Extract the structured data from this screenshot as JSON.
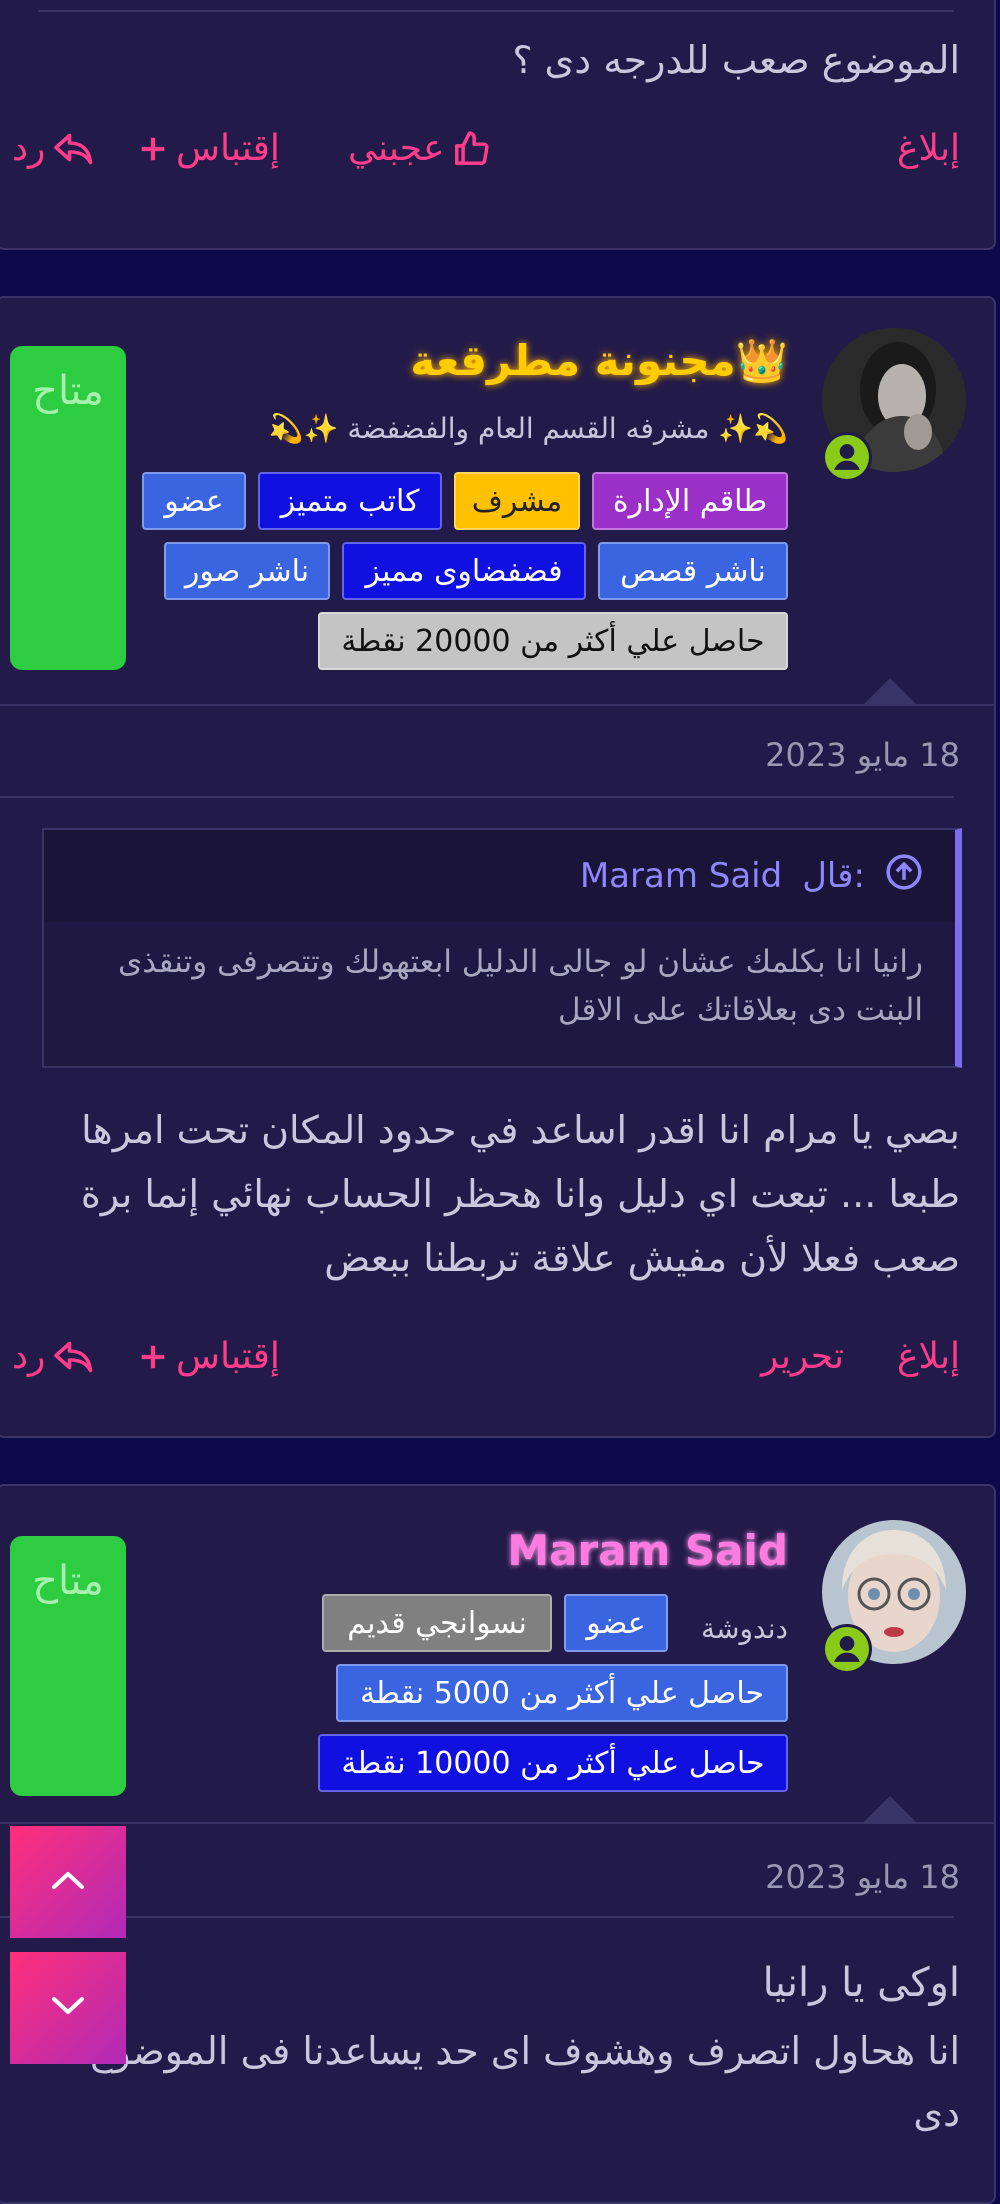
{
  "colors": {
    "accent": "#ff3d8b",
    "available": "#2ecc40",
    "background": "#0c0a4a",
    "card": "#221a48",
    "quote_bar": "#7b6cf0"
  },
  "post1": {
    "message": "الموضوع صعب للدرجه دى ؟",
    "actions": {
      "report": "إبلاغ",
      "like": "عجبني",
      "quote": "إقتباس",
      "reply": "رد"
    }
  },
  "post2": {
    "author": {
      "name": "👑مجنونة مطرقعة",
      "title": "💫✨ مشرفه القسم العام والفضفضة ✨💫",
      "status": "متاح"
    },
    "badges": [
      "طاقم الإدارة",
      "مشرف",
      "كاتب متميز",
      "عضو",
      "ناشر قصص",
      "فضفضاوى مميز",
      "ناشر صور",
      "حاصل علي أكثر من 20000 نقطة"
    ],
    "date": "18 مايو 2023",
    "quote": {
      "author": "Maram Said",
      "said": "قال:",
      "text": "رانيا انا بكلمك عشان لو جالى الدليل ابعتهولك وتتصرفى وتنقذى البنت دى بعلاقاتك على الاقل"
    },
    "message": "بصي يا مرام انا اقدر اساعد في حدود المكان تحت امرها طبعا ... تبعت اي دليل وانا هحظر الحساب نهائي إنما برة صعب فعلا لأن مفيش علاقة تربطنا ببعض",
    "actions": {
      "report": "إبلاغ",
      "edit": "تحرير",
      "quote": "إقتباس",
      "reply": "رد"
    }
  },
  "post3": {
    "author": {
      "name": "Maram Said",
      "title": "دندوشة",
      "status": "متاح"
    },
    "badges": [
      "عضو",
      "نسوانجي قديم",
      "حاصل علي أكثر من 5000 نقطة",
      "حاصل علي أكثر من 10000 نقطة"
    ],
    "date": "18 مايو 2023",
    "message_line1": "اوكى يا رانيا",
    "message_line2": "انا هحاول اتصرف وهشوف اى حد يساعدنا فى الموضوع دى"
  },
  "icons": [
    "like-icon",
    "plus-icon",
    "reply-icon",
    "crown-icon",
    "user-online-icon",
    "arrow-up-circle-icon",
    "chevron-up-icon",
    "chevron-down-icon"
  ]
}
